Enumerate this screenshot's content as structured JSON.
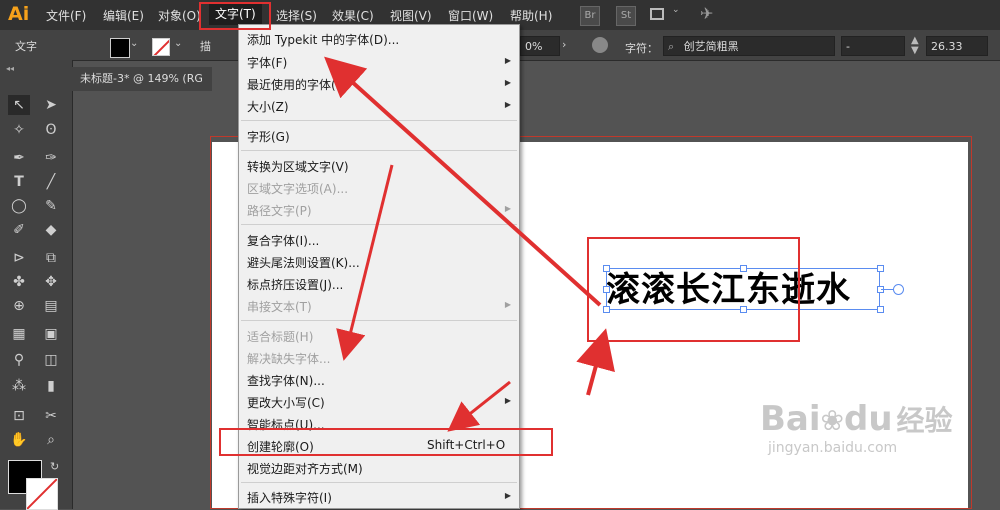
{
  "app_logo": "Ai",
  "menubar": {
    "items": [
      "文件(F)",
      "编辑(E)",
      "对象(O)",
      "文字(T)",
      "选择(S)",
      "效果(C)",
      "视图(V)",
      "窗口(W)",
      "帮助(H)"
    ],
    "active": "文字(T)",
    "br_label": "Br",
    "st_label": "St"
  },
  "control_bar": {
    "tool_label": "文字",
    "partial_label": "描",
    "opacity": "0%",
    "char_label": "字符：",
    "font_name": "创艺简粗黑",
    "font_style": "-",
    "font_size": "26.33"
  },
  "document_tab": {
    "title": "未标题-3* @ 149% (RG"
  },
  "artwork": {
    "text": "滚滚长江东逝水"
  },
  "type_menu": {
    "items": [
      {
        "label": "添加 Typekit 中的字体(D)...",
        "disabled": false,
        "submenu": false
      },
      {
        "label": "字体(F)",
        "disabled": false,
        "submenu": true
      },
      {
        "label": "最近使用的字体(R)",
        "disabled": false,
        "submenu": true
      },
      {
        "label": "大小(Z)",
        "disabled": false,
        "submenu": true
      },
      {
        "label": "字形(G)",
        "disabled": false,
        "submenu": false
      },
      {
        "label": "转换为区域文字(V)",
        "disabled": false,
        "submenu": false
      },
      {
        "label": "区域文字选项(A)...",
        "disabled": true,
        "submenu": false
      },
      {
        "label": "路径文字(P)",
        "disabled": true,
        "submenu": true
      },
      {
        "label": "复合字体(I)...",
        "disabled": false,
        "submenu": false
      },
      {
        "label": "避头尾法则设置(K)...",
        "disabled": false,
        "submenu": false
      },
      {
        "label": "标点挤压设置(J)...",
        "disabled": false,
        "submenu": false
      },
      {
        "label": "串接文本(T)",
        "disabled": true,
        "submenu": true
      },
      {
        "label": "适合标题(H)",
        "disabled": true,
        "submenu": false
      },
      {
        "label": "解决缺失字体...",
        "disabled": true,
        "submenu": false
      },
      {
        "label": "查找字体(N)...",
        "disabled": false,
        "submenu": false
      },
      {
        "label": "更改大小写(C)",
        "disabled": false,
        "submenu": true
      },
      {
        "label": "智能标点(U)...",
        "disabled": false,
        "submenu": false
      },
      {
        "label": "创建轮廓(O)",
        "disabled": false,
        "submenu": false,
        "shortcut": "Shift+Ctrl+O"
      },
      {
        "label": "视觉边距对齐方式(M)",
        "disabled": false,
        "submenu": false
      },
      {
        "label": "插入特殊字符(I)",
        "disabled": false,
        "submenu": true
      }
    ]
  },
  "watermark": {
    "brand": "Bai",
    "brand2": "du",
    "cn": "经验",
    "url": "jingyan.baidu.com"
  },
  "colors": {
    "annotation_red": "#e03030",
    "selection_blue": "#5a8cf0",
    "logo_orange": "#f7a21b"
  }
}
